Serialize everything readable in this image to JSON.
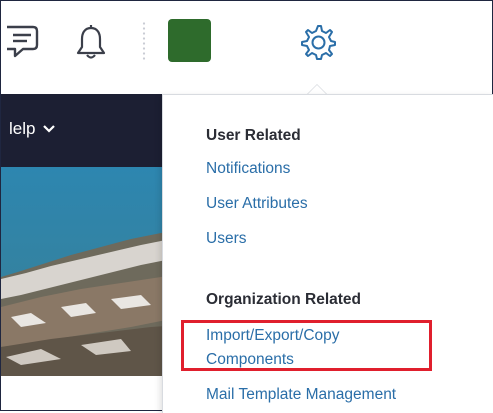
{
  "toolbar": {
    "icons": [
      "chat-icon",
      "bell-icon",
      "gear-icon"
    ],
    "avatar_color": "#2e6b2c"
  },
  "navbar": {
    "help_label": "lelp"
  },
  "dropdown": {
    "section_user": "User Related",
    "user_items": [
      "Notifications",
      "User Attributes",
      "Users"
    ],
    "section_org": "Organization Related",
    "org_items": [
      "Import/Export/Copy Components",
      "Mail Template Management"
    ],
    "import_line1": "Import/Export/Copy",
    "import_line2": "Components"
  },
  "colors": {
    "navbar_bg": "#1c1f33",
    "link": "#2a6ea8",
    "highlight": "#e01f2d"
  }
}
